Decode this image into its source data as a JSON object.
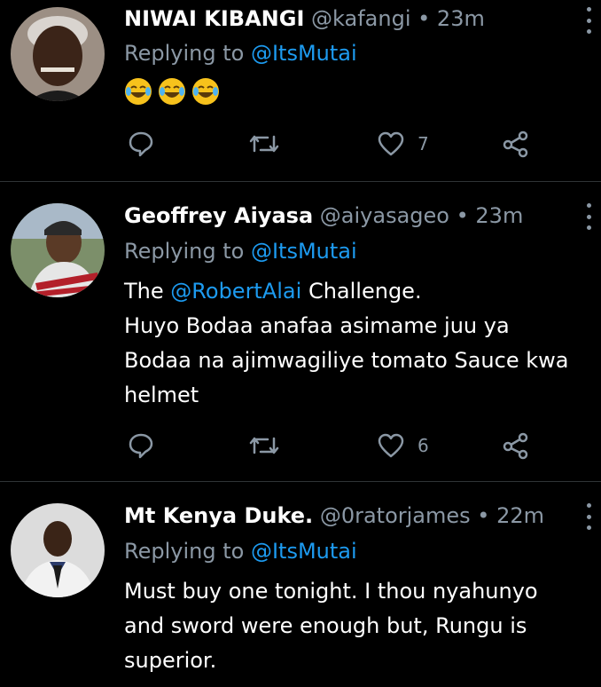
{
  "tweets": [
    {
      "name": "NIWAI KIBANGI",
      "handle": "@kafangi",
      "sep": "•",
      "time": "23m",
      "replying_prefix": "Replying to",
      "replying_to": "@ItsMutai",
      "text_emojis": [
        "face-with-tears-of-joy",
        "face-with-tears-of-joy",
        "face-with-tears-of-joy"
      ],
      "likes": "7"
    },
    {
      "name": "Geoffrey Aiyasa",
      "handle": "@aiyasageo",
      "sep": "•",
      "time": "23m",
      "replying_prefix": "Replying to",
      "replying_to": "@ItsMutai",
      "text_line1_prefix": "The",
      "text_line1_mention": "@RobertAlai",
      "text_line1_suffix": "Challenge.",
      "text_line2": "Huyo Bodaa anafaa asimame juu ya",
      "text_line3": "Bodaa na ajimwagiliye tomato Sauce kwa",
      "text_line4": "helmet",
      "likes": "6"
    },
    {
      "name": "Mt Kenya Duke.",
      "handle": "@0ratorjames",
      "sep": "•",
      "time": "22m",
      "replying_prefix": "Replying to",
      "replying_to": "@ItsMutai",
      "text_line1": "Must buy one tonight. I thou nyahunyo",
      "text_line2": "and sword were enough but, Rungu is",
      "text_line3": "superior."
    }
  ],
  "colors": {
    "background": "#000000",
    "secondary_text": "#8b98a5",
    "link": "#1d9bf0",
    "divider": "#2f3336"
  },
  "icons": [
    "reply-icon",
    "retweet-icon",
    "like-icon",
    "share-icon",
    "more-icon"
  ]
}
